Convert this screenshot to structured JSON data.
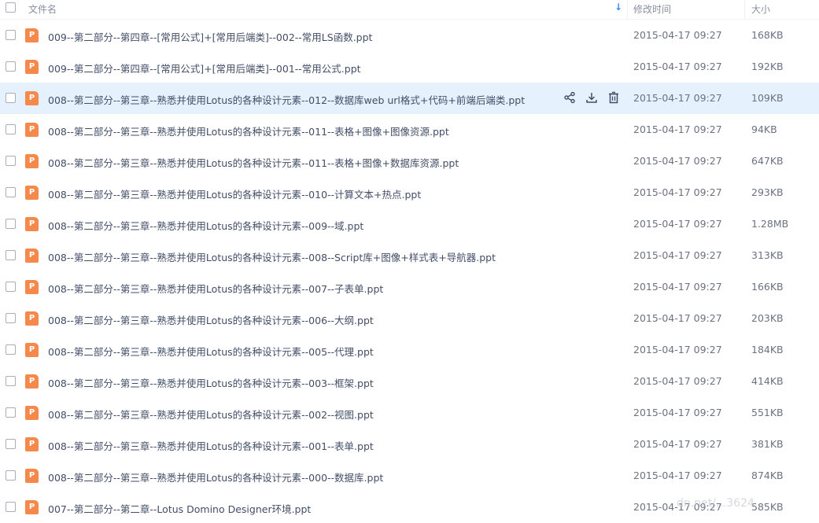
{
  "header": {
    "name_label": "文件名",
    "time_label": "修改时间",
    "size_label": "大小",
    "sort_icon": "sort-down-arrow"
  },
  "file_icon_letter": "P",
  "accent_color": "#3b8cff",
  "file_icon_color": "#f5894b",
  "files": [
    {
      "name": "009--第二部分--第四章--[常用公式]+[常用后端类]--002--常用LS函数.ppt",
      "time": "2015-04-17 09:27",
      "size": "168KB",
      "hover": false
    },
    {
      "name": "009--第二部分--第四章--[常用公式]+[常用后端类]--001--常用公式.ppt",
      "time": "2015-04-17 09:27",
      "size": "192KB",
      "hover": false
    },
    {
      "name": "008--第二部分--第三章--熟悉并使用Lotus的各种设计元素--012--数据库web url格式+代码+前端后端类.ppt",
      "time": "2015-04-17 09:27",
      "size": "109KB",
      "hover": true
    },
    {
      "name": "008--第二部分--第三章--熟悉并使用Lotus的各种设计元素--011--表格+图像+图像资源.ppt",
      "time": "2015-04-17 09:27",
      "size": "94KB",
      "hover": false
    },
    {
      "name": "008--第二部分--第三章--熟悉并使用Lotus的各种设计元素--011--表格+图像+数据库资源.ppt",
      "time": "2015-04-17 09:27",
      "size": "647KB",
      "hover": false
    },
    {
      "name": "008--第二部分--第三章--熟悉并使用Lotus的各种设计元素--010--计算文本+热点.ppt",
      "time": "2015-04-17 09:27",
      "size": "293KB",
      "hover": false
    },
    {
      "name": "008--第二部分--第三章--熟悉并使用Lotus的各种设计元素--009--域.ppt",
      "time": "2015-04-17 09:27",
      "size": "1.28MB",
      "hover": false
    },
    {
      "name": "008--第二部分--第三章--熟悉并使用Lotus的各种设计元素--008--Script库+图像+样式表+导航器.ppt",
      "time": "2015-04-17 09:27",
      "size": "313KB",
      "hover": false
    },
    {
      "name": "008--第二部分--第三章--熟悉并使用Lotus的各种设计元素--007--子表单.ppt",
      "time": "2015-04-17 09:27",
      "size": "166KB",
      "hover": false
    },
    {
      "name": "008--第二部分--第三章--熟悉并使用Lotus的各种设计元素--006--大纲.ppt",
      "time": "2015-04-17 09:27",
      "size": "203KB",
      "hover": false
    },
    {
      "name": "008--第二部分--第三章--熟悉并使用Lotus的各种设计元素--005--代理.ppt",
      "time": "2015-04-17 09:27",
      "size": "184KB",
      "hover": false
    },
    {
      "name": "008--第二部分--第三章--熟悉并使用Lotus的各种设计元素--003--框架.ppt",
      "time": "2015-04-17 09:27",
      "size": "414KB",
      "hover": false
    },
    {
      "name": "008--第二部分--第三章--熟悉并使用Lotus的各种设计元素--002--视图.ppt",
      "time": "2015-04-17 09:27",
      "size": "551KB",
      "hover": false
    },
    {
      "name": "008--第二部分--第三章--熟悉并使用Lotus的各种设计元素--001--表单.ppt",
      "time": "2015-04-17 09:27",
      "size": "381KB",
      "hover": false
    },
    {
      "name": "008--第二部分--第三章--熟悉并使用Lotus的各种设计元素--000--数据库.ppt",
      "time": "2015-04-17 09:27",
      "size": "874KB",
      "hover": false
    },
    {
      "name": "007--第二部分--第二章--Lotus Domino Designer环境.ppt",
      "time": "2015-04-17 09:27",
      "size": "585KB",
      "hover": false
    }
  ],
  "watermark": "dn.net/...3624"
}
